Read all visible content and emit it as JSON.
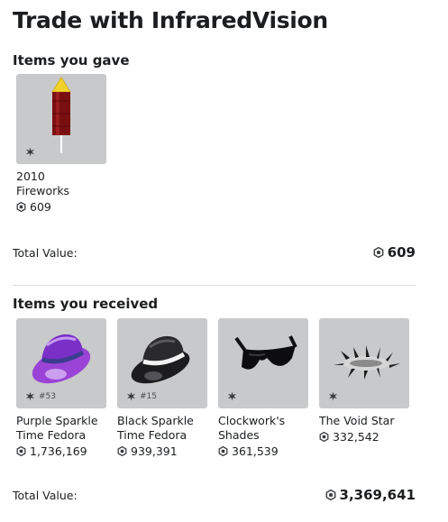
{
  "title": "Trade with InfraredVision",
  "gave": {
    "heading": "Items you gave",
    "items": [
      {
        "name": "2010 Fireworks",
        "price": "609",
        "serial": ""
      }
    ],
    "total_label": "Total Value:",
    "total_value": "609"
  },
  "received": {
    "heading": "Items you received",
    "items": [
      {
        "name": "Purple Sparkle Time Fedora",
        "price": "1,736,169",
        "serial": "#53"
      },
      {
        "name": "Black Sparkle Time Fedora",
        "price": "939,391",
        "serial": "#15"
      },
      {
        "name": "Clockwork's Shades",
        "price": "361,539",
        "serial": ""
      },
      {
        "name": "The Void Star",
        "price": "332,542",
        "serial": ""
      }
    ],
    "total_label": "Total Value:",
    "total_value": "3,369,641"
  },
  "icons": {
    "limited": "limited-star-icon",
    "currency": "robux-icon"
  },
  "colors": {
    "background": "#ffffff",
    "thumbnail": "#c8c9ca",
    "text": "#1b1d1f",
    "divider": "#dcdde0"
  }
}
